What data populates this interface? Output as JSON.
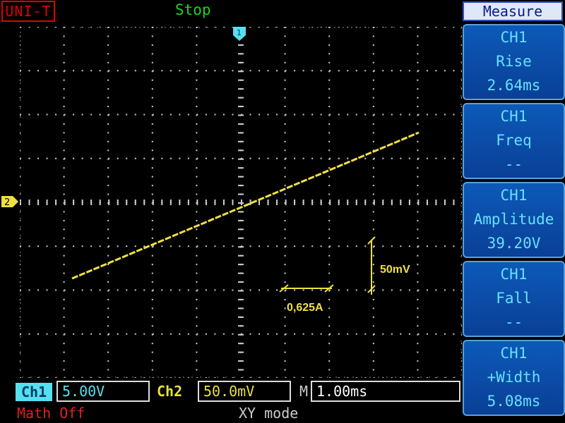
{
  "header": {
    "brand": "UNI-T",
    "status": "Stop"
  },
  "screen": {
    "trigger_marker": "1",
    "ch_marker": "2",
    "scale_x": "0,625A",
    "scale_y": "50mV"
  },
  "menu": {
    "title": "Measure",
    "items": [
      {
        "channel": "CH1",
        "name": "Rise",
        "value": "2.64ms"
      },
      {
        "channel": "CH1",
        "name": "Freq",
        "value": "--"
      },
      {
        "channel": "CH1",
        "name": "Amplitude",
        "value": "39.20V"
      },
      {
        "channel": "CH1",
        "name": "Fall",
        "value": "--"
      },
      {
        "channel": "CH1",
        "name": "+Width",
        "value": "5.08ms"
      }
    ]
  },
  "footer": {
    "ch1_label": "Ch1",
    "ch1_value": "5.00V",
    "ch2_label": "Ch2",
    "ch2_value": "50.0mV",
    "time_label": "M",
    "time_value": "1.00ms",
    "math": "Math Off",
    "mode": "XY mode"
  },
  "colors": {
    "trace": "#f0e040",
    "grid": "#d0d0d0",
    "menu_bg": "#0a4aa8",
    "ch1": "#55e0f0"
  }
}
